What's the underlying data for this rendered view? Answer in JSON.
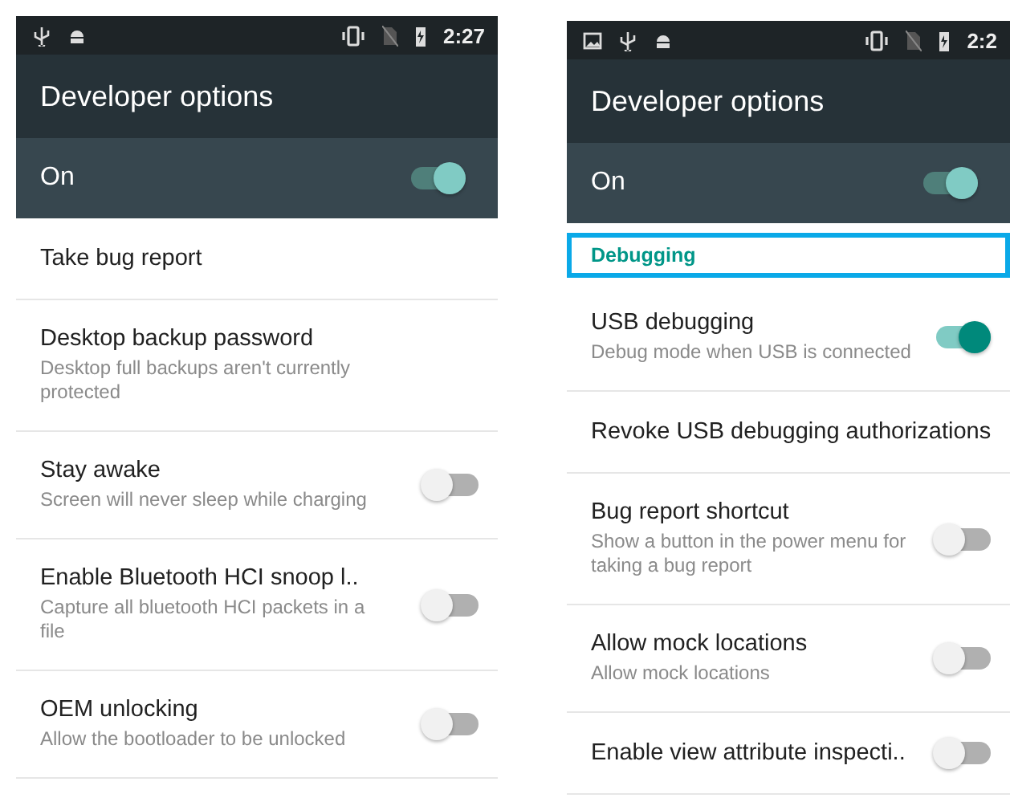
{
  "phones": [
    {
      "status_bar": {
        "time": "2:27",
        "image_notification": false
      },
      "title": "Developer options",
      "master": {
        "label": "On",
        "on": true
      },
      "items": [
        {
          "kind": "setting",
          "title": "Take bug report"
        },
        {
          "kind": "setting",
          "title": "Desktop backup password",
          "summary": "Desktop full backups aren't currently protected"
        },
        {
          "kind": "toggle",
          "title": "Stay awake",
          "summary": "Screen will never sleep while charging",
          "on": false
        },
        {
          "kind": "toggle",
          "title": "Enable Bluetooth HCI snoop l..",
          "summary": "Capture all bluetooth HCI packets in a file",
          "on": false
        },
        {
          "kind": "toggle",
          "title": "OEM unlocking",
          "summary": "Allow the bootloader to be unlocked",
          "on": false
        }
      ]
    },
    {
      "status_bar": {
        "time": "2:2",
        "image_notification": true
      },
      "title": "Developer options",
      "master": {
        "label": "On",
        "on": true
      },
      "items": [
        {
          "kind": "category",
          "title": "Debugging",
          "highlighted": true
        },
        {
          "kind": "toggle",
          "title": "USB debugging",
          "summary": "Debug mode when USB is connected",
          "on": true
        },
        {
          "kind": "setting",
          "title": "Revoke USB debugging authorizations"
        },
        {
          "kind": "toggle",
          "title": "Bug report shortcut",
          "summary": "Show a button in the power menu for taking a bug report",
          "on": false
        },
        {
          "kind": "toggle",
          "title": "Allow mock locations",
          "summary": "Allow mock locations",
          "on": false
        },
        {
          "kind": "toggle",
          "title": "Enable view attribute inspecti..",
          "on": false
        }
      ]
    }
  ]
}
